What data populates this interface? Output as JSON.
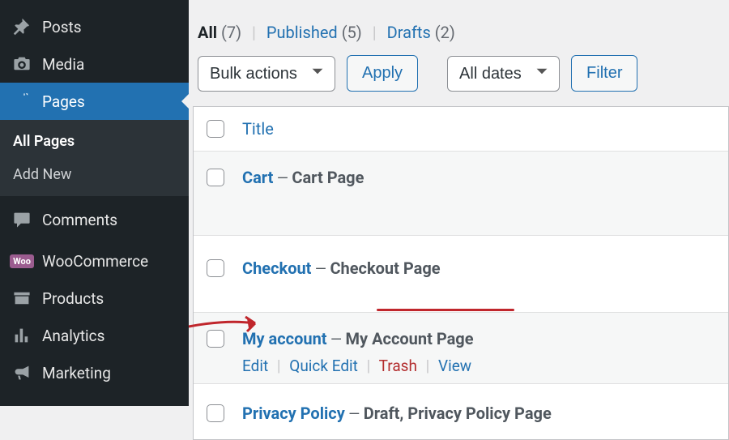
{
  "sidebar": {
    "items": [
      {
        "key": "posts",
        "label": "Posts",
        "icon": "pin"
      },
      {
        "key": "media",
        "label": "Media",
        "icon": "camera"
      },
      {
        "key": "pages",
        "label": "Pages",
        "icon": "pages",
        "active": true
      },
      {
        "key": "comments",
        "label": "Comments",
        "icon": "comment"
      },
      {
        "key": "woocommerce",
        "label": "WooCommerce",
        "icon": "woo"
      },
      {
        "key": "products",
        "label": "Products",
        "icon": "archive"
      },
      {
        "key": "analytics",
        "label": "Analytics",
        "icon": "bars"
      },
      {
        "key": "marketing",
        "label": "Marketing",
        "icon": "megaphone"
      }
    ],
    "submenu": [
      {
        "key": "all-pages",
        "label": "All Pages",
        "current": true
      },
      {
        "key": "add-new",
        "label": "Add New"
      }
    ]
  },
  "filters": {
    "all": {
      "label": "All",
      "count": "(7)"
    },
    "published": {
      "label": "Published",
      "count": "(5)"
    },
    "drafts": {
      "label": "Drafts",
      "count": "(2)"
    }
  },
  "toolbar": {
    "bulk_placeholder": "Bulk actions",
    "apply_label": "Apply",
    "dates_placeholder": "All dates",
    "filter_label": "Filter"
  },
  "table": {
    "col_title": "Title",
    "rows": [
      {
        "title": "Cart",
        "dash": " — ",
        "states": "Cart Page",
        "highlight": true
      },
      {
        "title": "Checkout",
        "dash": " — ",
        "states": "Checkout Page"
      },
      {
        "title": "My account",
        "dash": " — ",
        "states": "My Account Page",
        "highlight": true,
        "actions": {
          "edit": "Edit",
          "quick": "Quick Edit",
          "trash": "Trash",
          "view": "View"
        }
      },
      {
        "title": "Privacy Policy",
        "dash": " — ",
        "states": "Draft, Privacy Policy Page"
      }
    ]
  }
}
